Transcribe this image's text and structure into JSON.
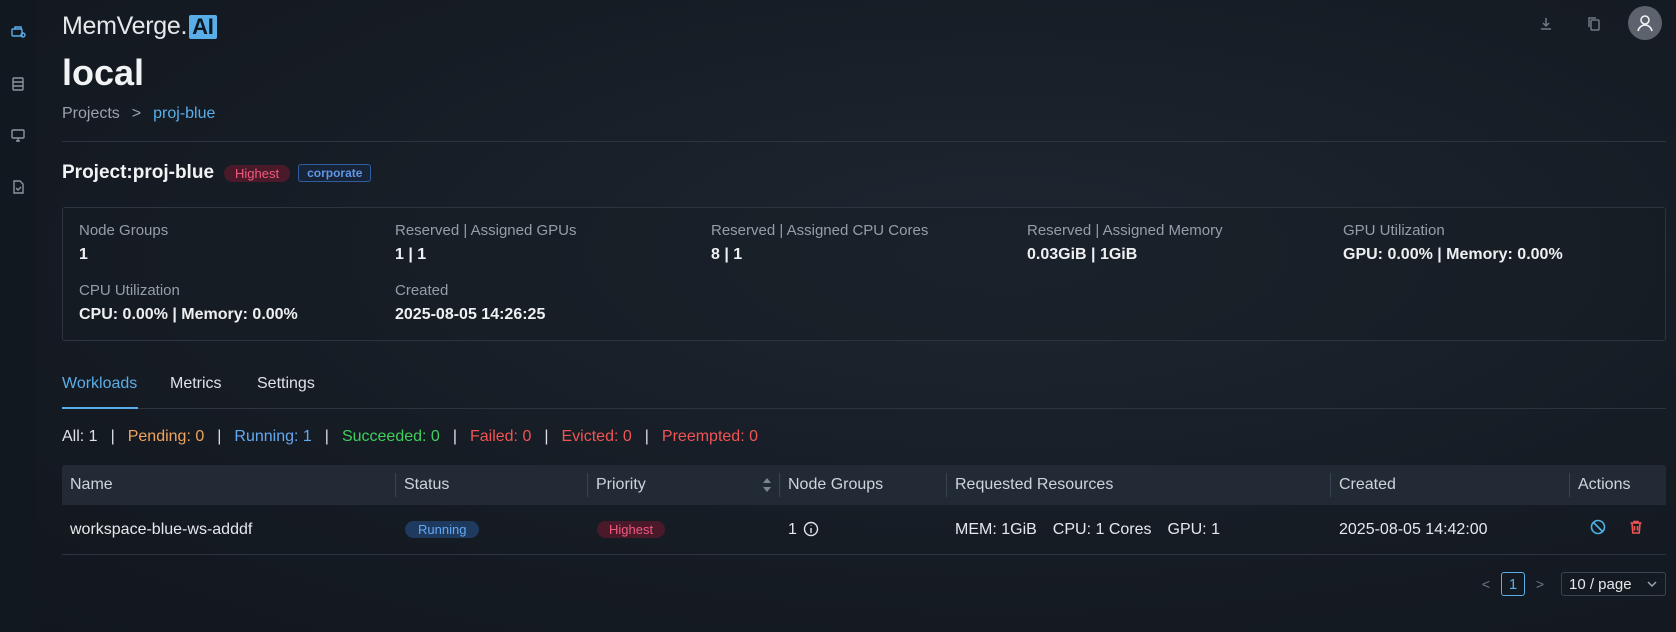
{
  "brand": {
    "name": "MemVerge.",
    "ai": "AI"
  },
  "env_title": "local",
  "breadcrumb": {
    "root": "Projects",
    "sep": ">",
    "current": "proj-blue"
  },
  "project": {
    "title": "Project:proj-blue",
    "priority_tag": "Highest",
    "dept_tag": "corporate"
  },
  "info": [
    {
      "label": "Node Groups",
      "value": "1"
    },
    {
      "label": "Reserved | Assigned GPUs",
      "value": "1 | 1"
    },
    {
      "label": "Reserved | Assigned CPU Cores",
      "value": "8 | 1"
    },
    {
      "label": "Reserved | Assigned Memory",
      "value": "0.03GiB | 1GiB"
    },
    {
      "label": "GPU Utilization",
      "value": "GPU: 0.00% | Memory: 0.00%"
    },
    {
      "label": "CPU Utilization",
      "value": "CPU: 0.00% | Memory: 0.00%"
    },
    {
      "label": "Created",
      "value": "2025-08-05 14:26:25"
    }
  ],
  "tabs": [
    "Workloads",
    "Metrics",
    "Settings"
  ],
  "filters": {
    "all": "All: 1",
    "pending": "Pending: 0",
    "running": "Running: 1",
    "succeeded": "Succeeded: 0",
    "failed": "Failed: 0",
    "evicted": "Evicted: 0",
    "preempted": "Preempted: 0",
    "sep": "|"
  },
  "colors": {
    "pending": "#f0a45d",
    "running": "#64a8f2",
    "succeeded": "#3fcf5c",
    "failed": "#f05454",
    "accent": "#5aaee8"
  },
  "table": {
    "columns": [
      "Name",
      "Status",
      "Priority",
      "Node Groups",
      "Requested Resources",
      "Created",
      "Actions"
    ],
    "rows": [
      {
        "name": "workspace-blue-ws-adddf",
        "status": "Running",
        "priority": "Highest",
        "node_groups": "1",
        "mem": "MEM: 1GiB",
        "cpu": "CPU: 1 Cores",
        "gpu": "GPU: 1",
        "created": "2025-08-05 14:42:00"
      }
    ]
  },
  "pagination": {
    "prev": "<",
    "page": "1",
    "next": ">",
    "page_size": "10 / page"
  },
  "icons": {
    "rail": [
      "projects-icon",
      "list-icon",
      "monitor-icon",
      "task-icon"
    ],
    "top": [
      "download-icon",
      "copy-icon",
      "user-icon"
    ],
    "actions": [
      "stop-icon",
      "delete-icon"
    ]
  }
}
